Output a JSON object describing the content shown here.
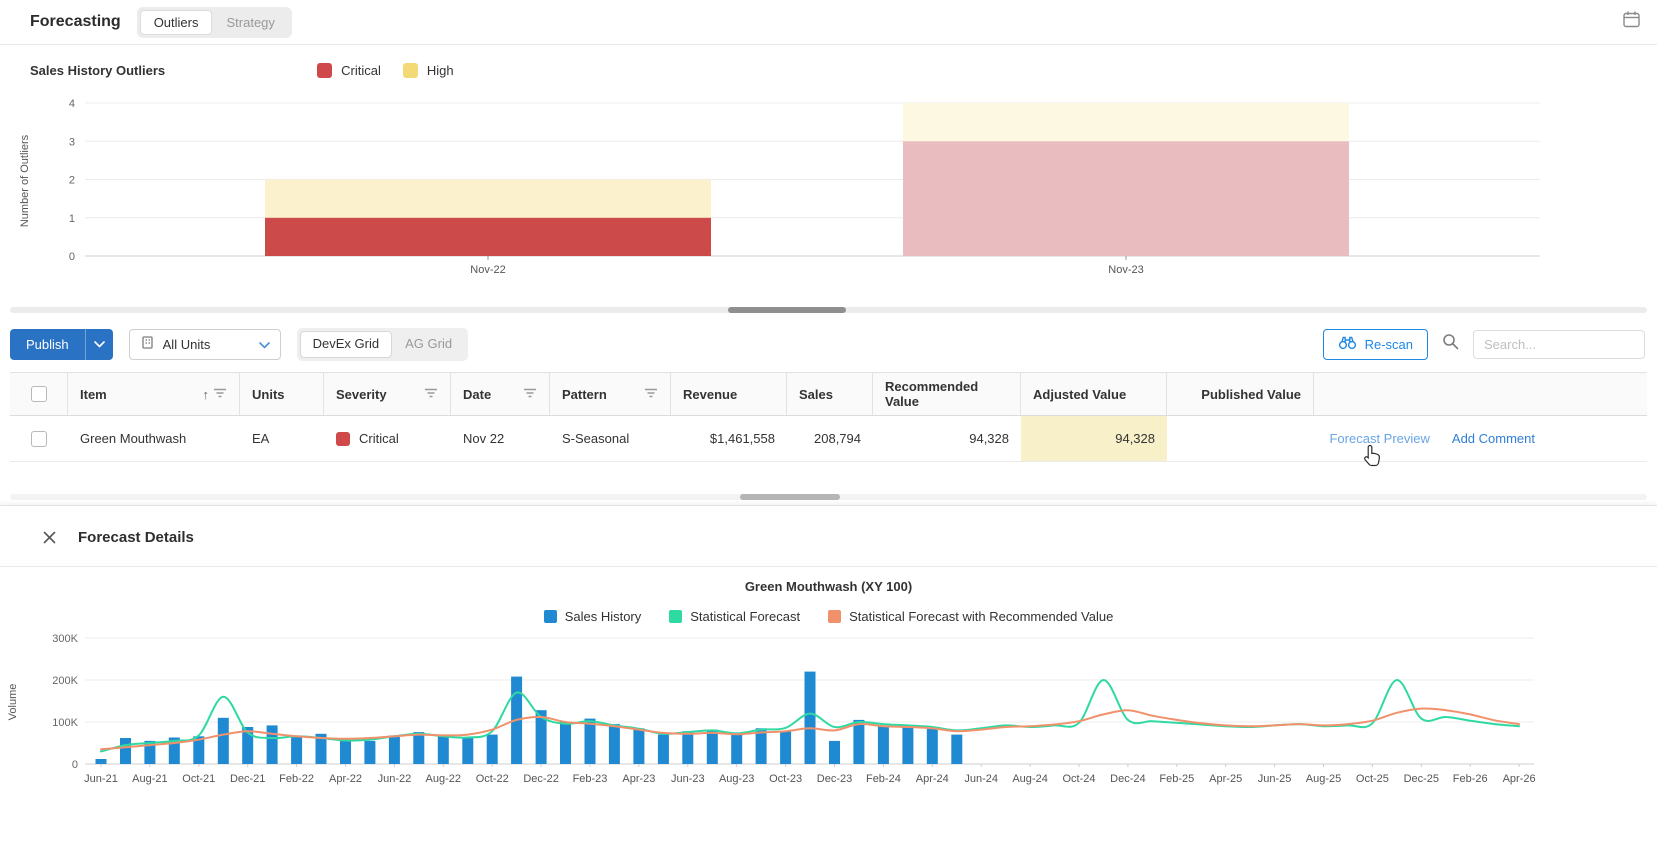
{
  "colors": {
    "accent_blue": "#2a72c4",
    "rescan_blue": "#1e88e5",
    "link_blue": "#2f7ed8",
    "link_blue_light": "#6aa5e6",
    "highlight_yellow": "#f8f0c8"
  },
  "header": {
    "title": "Forecasting",
    "tabs": [
      {
        "label": "Outliers",
        "active": true
      },
      {
        "label": "Strategy",
        "active": false
      }
    ]
  },
  "outliers_section": {
    "legend_title": "Sales History Outliers",
    "legend": [
      {
        "label": "Critical",
        "color": "#d0494a"
      },
      {
        "label": "High",
        "color": "#f4d977"
      }
    ]
  },
  "toolbar": {
    "publish_label": "Publish",
    "units_filter": "All Units",
    "grid_toggle": [
      {
        "label": "DevEx Grid",
        "active": true
      },
      {
        "label": "AG Grid",
        "active": false
      }
    ],
    "rescan_label": "Re-scan",
    "search_placeholder": "Search..."
  },
  "table": {
    "columns": [
      "Item",
      "Units",
      "Severity",
      "Date",
      "Pattern",
      "Revenue",
      "Sales",
      "Recommended Value",
      "Adjusted Value",
      "Published Value"
    ],
    "rows": [
      {
        "item": "Green Mouthwash",
        "units": "EA",
        "severity": "Critical",
        "severity_color": "#d0494a",
        "date": "Nov 22",
        "pattern": "S-Seasonal",
        "revenue": "$1,461,558",
        "sales": "208,794",
        "recommended_value": "94,328",
        "adjusted_value": "94,328",
        "published_value": "",
        "actions": [
          "Forecast Preview",
          "Add Comment"
        ]
      }
    ]
  },
  "forecast_details": {
    "title": "Forecast Details"
  },
  "chart_data": [
    {
      "type": "bar",
      "title": "Sales History Outliers",
      "ylabel": "Number of Outliers",
      "ylim": [
        0,
        4
      ],
      "yticks": [
        0,
        1,
        2,
        3,
        4
      ],
      "categories": [
        "Nov-22",
        "Nov-23"
      ],
      "faded": [
        false,
        true
      ],
      "series": [
        {
          "name": "High",
          "values": [
            2,
            4
          ],
          "color": "#fbf1cc",
          "faded_color": "#fdf8e2"
        },
        {
          "name": "Critical",
          "values": [
            1,
            3
          ],
          "color": "#cc4a4a",
          "faded_color": "#e9bcc0"
        }
      ]
    },
    {
      "type": "bar",
      "title": "Green Mouthwash (XY 100)",
      "ylabel": "Volume",
      "ylim": [
        0,
        300000
      ],
      "ytick_values": [
        0,
        100000,
        200000,
        300000
      ],
      "ytick_labels": [
        "0",
        "100K",
        "200K",
        "300K"
      ],
      "x_tick_every": 2,
      "x": [
        "Jun-21",
        "Jul-21",
        "Aug-21",
        "Sep-21",
        "Oct-21",
        "Nov-21",
        "Dec-21",
        "Jan-22",
        "Feb-22",
        "Mar-22",
        "Apr-22",
        "May-22",
        "Jun-22",
        "Jul-22",
        "Aug-22",
        "Sep-22",
        "Oct-22",
        "Nov-22",
        "Dec-22",
        "Jan-23",
        "Feb-23",
        "Mar-23",
        "Apr-23",
        "May-23",
        "Jun-23",
        "Jul-23",
        "Aug-23",
        "Sep-23",
        "Oct-23",
        "Nov-23",
        "Dec-23",
        "Jan-24",
        "Feb-24",
        "Mar-24",
        "Apr-24",
        "May-24",
        "Jun-24",
        "Jul-24",
        "Aug-24",
        "Sep-24",
        "Oct-24",
        "Nov-24",
        "Dec-24",
        "Jan-25",
        "Feb-25",
        "Mar-25",
        "Apr-25",
        "May-25",
        "Jun-25",
        "Jul-25",
        "Aug-25",
        "Sep-25",
        "Oct-25",
        "Nov-25",
        "Dec-25",
        "Jan-26",
        "Feb-26",
        "Mar-26",
        "Apr-26"
      ],
      "series": [
        {
          "name": "Sales History",
          "kind": "bar",
          "color": "#1f8ad2",
          "values": [
            12000,
            62000,
            55000,
            63000,
            66000,
            110000,
            88000,
            92000,
            65000,
            72000,
            58000,
            55000,
            68000,
            76000,
            68000,
            64000,
            70000,
            208000,
            128000,
            100000,
            108000,
            95000,
            85000,
            70000,
            78000,
            82000,
            72000,
            85000,
            78000,
            220000,
            55000,
            105000,
            92000,
            90000,
            85000,
            70000
          ]
        },
        {
          "name": "Statistical Forecast",
          "kind": "line",
          "color": "#2fd9a2",
          "values": [
            30000,
            45000,
            50000,
            55000,
            68000,
            160000,
            75000,
            62000,
            66000,
            62000,
            56000,
            58000,
            66000,
            72000,
            66000,
            63000,
            78000,
            170000,
            112000,
            96000,
            102000,
            92000,
            84000,
            72000,
            76000,
            80000,
            73000,
            82000,
            86000,
            120000,
            88000,
            100000,
            95000,
            92000,
            88000,
            80000,
            85000,
            92000,
            88000,
            92000,
            98000,
            200000,
            105000,
            102000,
            98000,
            94000,
            90000,
            88000,
            92000,
            95000,
            90000,
            92000,
            97000,
            200000,
            108000,
            112000,
            103000,
            95000,
            90000
          ]
        },
        {
          "name": "Statistical Forecast with Recommended Value",
          "kind": "line",
          "color": "#f0916c",
          "values": [
            35000,
            40000,
            45000,
            50000,
            58000,
            70000,
            78000,
            72000,
            66000,
            62000,
            60000,
            62000,
            66000,
            70000,
            68000,
            70000,
            82000,
            105000,
            112000,
            100000,
            96000,
            90000,
            82000,
            74000,
            72000,
            74000,
            71000,
            75000,
            78000,
            85000,
            80000,
            95000,
            90000,
            88000,
            85000,
            78000,
            82000,
            88000,
            90000,
            94000,
            102000,
            118000,
            128000,
            115000,
            105000,
            97000,
            92000,
            90000,
            92000,
            95000,
            92000,
            95000,
            103000,
            122000,
            132000,
            128000,
            118000,
            104000,
            95000
          ]
        }
      ]
    }
  ]
}
